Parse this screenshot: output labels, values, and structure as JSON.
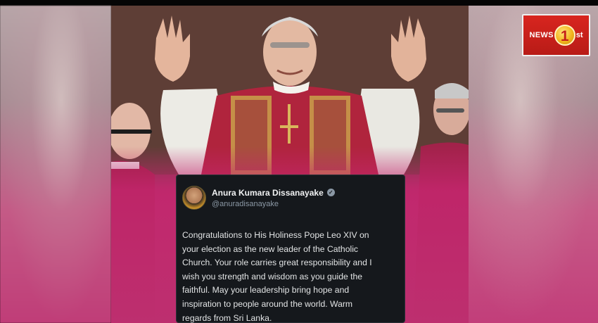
{
  "broadcast_logo": {
    "text_news": "NEWS",
    "text_one": "1",
    "text_st": "st",
    "brand_color": "#c41e1a",
    "accent_color": "#f2b51e"
  },
  "tweet": {
    "display_name": "Anura Kumara Dissanayake",
    "verified_icon": "verified-badge-icon",
    "handle": "@anuradisanayake",
    "body": "Congratulations to His Holiness Pope Leo XIV on\nyour election as the new leader of the Catholic\nChurch. Your role carries great responsibility and I\nwish you strength and wisdom as you guide the\nfaithful. May your leadership bring hope and\ninspiration to people around the world. Warm\nregards from Sri Lanka."
  },
  "colors": {
    "card_background": "#15181c",
    "overlay_pink": "#bd2f6f",
    "vestment_red": "#b0243d",
    "vestment_gold": "#c9a24a"
  }
}
